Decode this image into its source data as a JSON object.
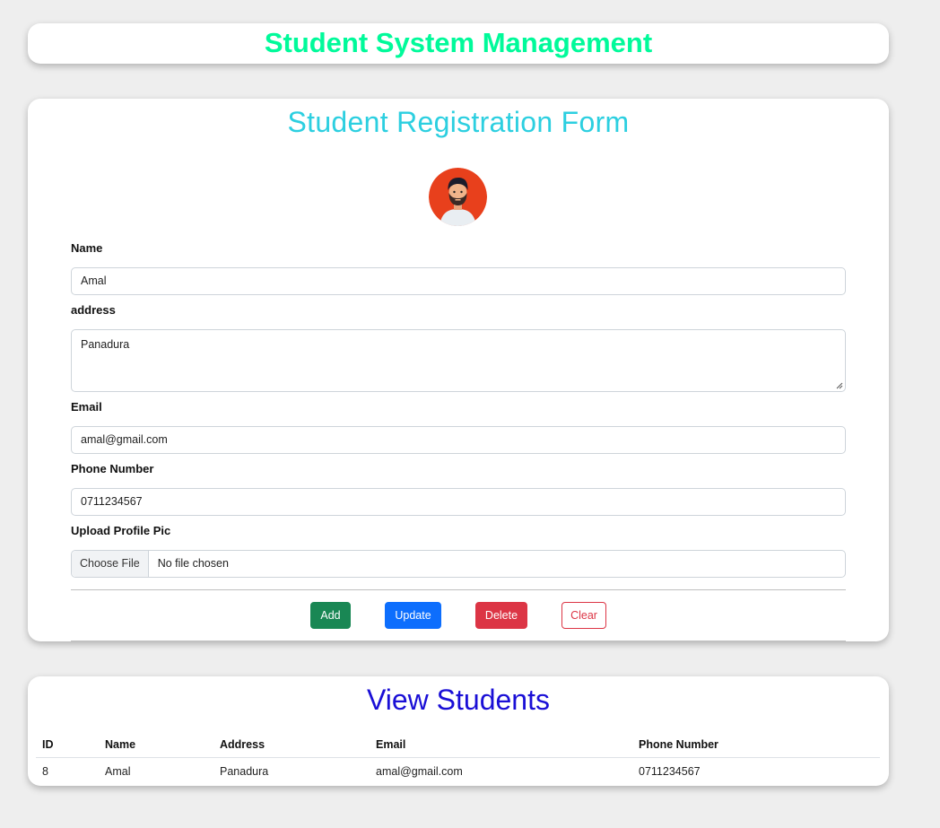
{
  "header": {
    "title": "Student System Management"
  },
  "form": {
    "title": "Student Registration Form",
    "fields": {
      "name": {
        "label": "Name",
        "value": "Amal"
      },
      "address": {
        "label": "address",
        "value": "Panadura"
      },
      "email": {
        "label": "Email",
        "value": "amal@gmail.com"
      },
      "phone": {
        "label": "Phone Number",
        "value": "0711234567"
      },
      "upload": {
        "label": "Upload Profile Pic",
        "button": "Choose File",
        "status": "No file chosen"
      }
    },
    "buttons": {
      "add": "Add",
      "update": "Update",
      "delete": "Delete",
      "clear": "Clear"
    },
    "avatar_icon": "avatar-icon"
  },
  "students": {
    "title": "View Students",
    "columns": [
      "ID",
      "Name",
      "Address",
      "Email",
      "Phone Number"
    ],
    "rows": [
      [
        "8",
        "Amal",
        "Panadura",
        "amal@gmail.com",
        "0711234567"
      ]
    ]
  },
  "colors": {
    "header_title": "#00fa9a",
    "form_title": "#2ccfe0",
    "view_title": "#1a0fd6",
    "add": "#198754",
    "update": "#0d6efd",
    "delete": "#dc3545",
    "clear": "#dc3545"
  }
}
